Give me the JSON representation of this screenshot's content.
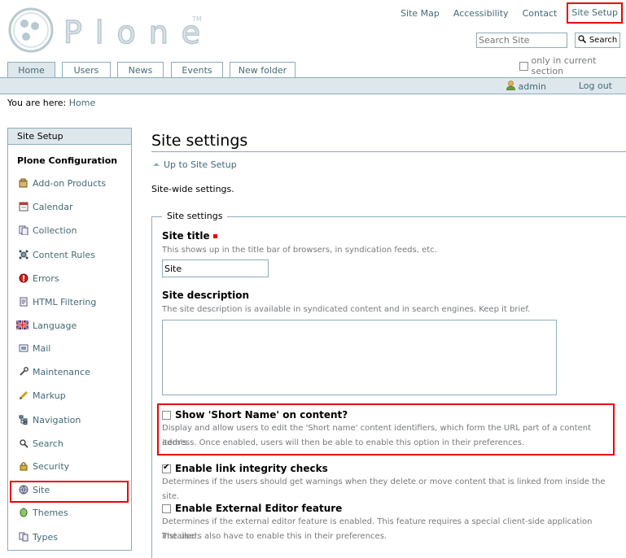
{
  "logo": {
    "text": "Plone",
    "tm": "TM"
  },
  "site_actions": [
    "Site Map",
    "Accessibility",
    "Contact",
    "Site Setup"
  ],
  "search": {
    "placeholder": "Search Site",
    "button": "Search",
    "only_current": "only in current section"
  },
  "tabs": [
    "Home",
    "Users",
    "News",
    "Events",
    "New folder"
  ],
  "personal": {
    "user": "admin",
    "logout": "Log out"
  },
  "breadcrumbs": {
    "prefix": "You are here:",
    "crumb": "Home"
  },
  "portlet": {
    "header": "Site Setup",
    "subheader": "Plone Configuration",
    "items": [
      "Add-on Products",
      "Calendar",
      "Collection",
      "Content Rules",
      "Errors",
      "HTML Filtering",
      "Language",
      "Mail",
      "Maintenance",
      "Markup",
      "Navigation",
      "Search",
      "Security",
      "Site",
      "Themes",
      "Types"
    ]
  },
  "main": {
    "title": "Site settings",
    "up_link": "Up to Site Setup",
    "description": "Site-wide settings.",
    "legend": "Site settings",
    "site_title_label": "Site title",
    "site_title_help": "This shows up in the title bar of browsers, in syndication feeds, etc.",
    "site_title_value": "Site",
    "site_desc_label": "Site description",
    "site_desc_help": "The site description is available in syndicated content and in search engines. Keep it brief.",
    "short_name_label": "Show 'Short Name' on content?",
    "short_name_help1": "Display and allow users to edit the 'Short name' content identifiers, which form the URL part of a content item's",
    "short_name_help2": "address. Once enabled, users will then be able to enable this option in their preferences.",
    "link_integrity_label": "Enable link integrity checks",
    "link_integrity_help": "Determines if the users should get warnings when they delete or move content that is linked from inside the site.",
    "ext_editor_label": "Enable External Editor feature",
    "ext_editor_help1": "Determines if the external editor feature is enabled. This feature requires a special client-side application installed.",
    "ext_editor_help2": "The users also have to enable this in their preferences."
  },
  "colors": {
    "link": "#436976",
    "border": "#8cacbb",
    "highlight": "#e00000",
    "bar": "#dee7ec"
  }
}
